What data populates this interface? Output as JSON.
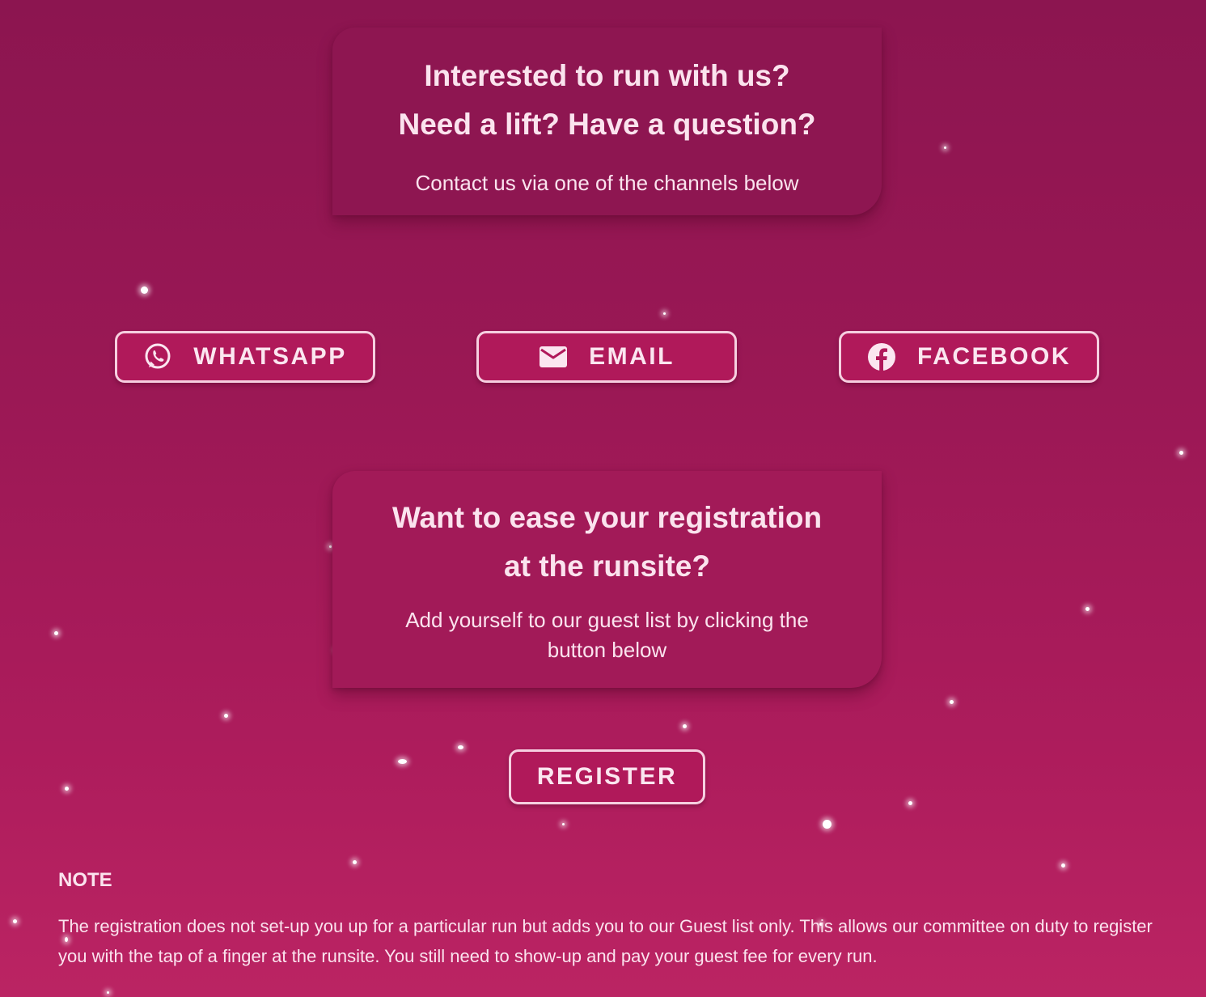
{
  "contact_card": {
    "heading_line1": "Interested to run with us?",
    "heading_line2": "Need a lift? Have a question?",
    "subtitle": "Contact us via one of the channels below"
  },
  "contact_buttons": {
    "whatsapp_label": "WHATSAPP",
    "whatsapp_icon": "whatsapp-icon",
    "email_label": "EMAIL",
    "email_icon": "mail-icon",
    "facebook_label": "FACEBOOK",
    "facebook_icon": "facebook-icon"
  },
  "registration_card": {
    "heading_line1": "Want to ease your registration",
    "heading_line2": "at the runsite?",
    "subtitle": "Add yourself to our guest list by clicking the button below"
  },
  "register_button": {
    "label": "REGISTER"
  },
  "note": {
    "title": "NOTE",
    "text": "The registration does not set-up you up for a particular run but adds you to our Guest list only. This allows our committee on duty to register you with the tap of a finger at the runsite. You still need to show-up and pay your guest fee for every run."
  },
  "colors": {
    "background_top": "#8c1550",
    "background_bottom": "#bb2463",
    "card_top": "#8e1651",
    "card_mid": "#a21a58",
    "button_fill": "#b0195a",
    "button_border": "#f6cfe0",
    "text": "#fbe3ee"
  }
}
